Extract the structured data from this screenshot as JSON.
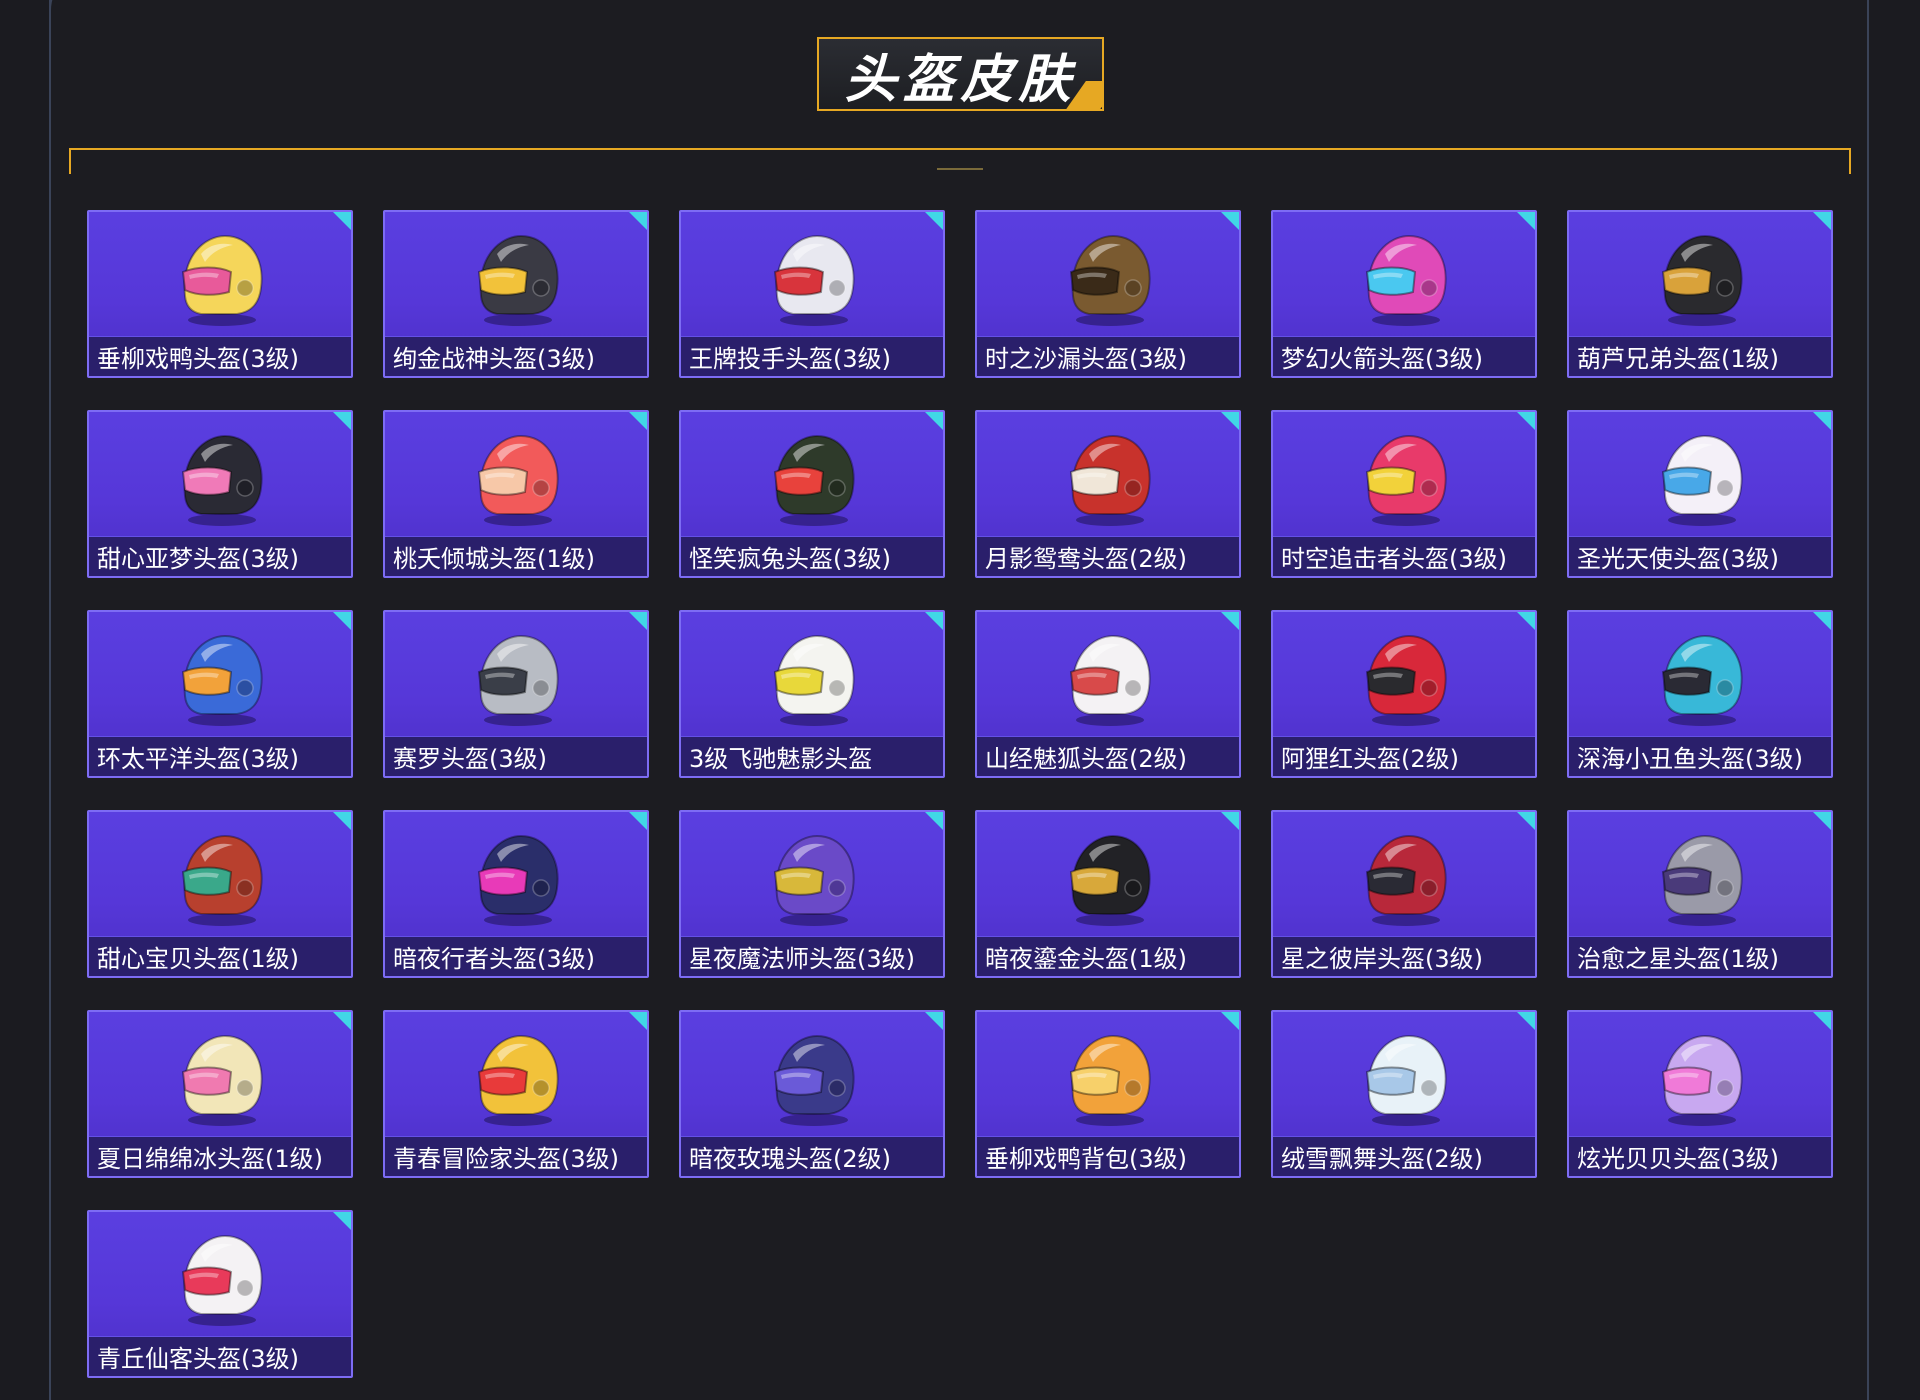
{
  "page": {
    "title": "头盔皮肤"
  },
  "colors": {
    "accent": "#e6a823",
    "card_bg": "#5a3fe0",
    "card_corner": "#41d7e6",
    "label_bg": "#2a1f6b"
  },
  "items": [
    {
      "label": "垂柳戏鸭头盔(3级)",
      "shell": "#f5d65a",
      "visor": "#e85a9a",
      "icon": "duck-helmet-icon"
    },
    {
      "label": "绚金战神头盔(3级)",
      "shell": "#3a3a44",
      "visor": "#f2c23a",
      "icon": "golden-warrior-helmet-icon"
    },
    {
      "label": "王牌投手头盔(3级)",
      "shell": "#e8e8f0",
      "visor": "#d8343c",
      "icon": "football-helmet-icon"
    },
    {
      "label": "时之沙漏头盔(3级)",
      "shell": "#7a5a30",
      "visor": "#3a2a18",
      "icon": "hourglass-helmet-icon"
    },
    {
      "label": "梦幻火箭头盔(3级)",
      "shell": "#e04ab8",
      "visor": "#4ac8f0",
      "icon": "rocket-helmet-icon"
    },
    {
      "label": "葫芦兄弟头盔(1级)",
      "shell": "#2a2a2e",
      "visor": "#d9a23a",
      "icon": "gourd-helmet-icon"
    },
    {
      "label": "甜心亚梦头盔(3级)",
      "shell": "#2a2a34",
      "visor": "#f07ab8",
      "icon": "sweet-dream-helmet-icon"
    },
    {
      "label": "桃夭倾城头盔(1级)",
      "shell": "#f25a5a",
      "visor": "#f7c8a8",
      "icon": "peach-helmet-icon"
    },
    {
      "label": "怪笑疯兔头盔(3级)",
      "shell": "#2e3a2a",
      "visor": "#e8423c",
      "icon": "crazy-rabbit-helmet-icon"
    },
    {
      "label": "月影鸳鸯头盔(2级)",
      "shell": "#c8322c",
      "visor": "#f0e6d8",
      "icon": "mandarin-duck-helmet-icon"
    },
    {
      "label": "时空追击者头盔(3级)",
      "shell": "#e83a6a",
      "visor": "#f2d23a",
      "icon": "time-chaser-helmet-icon"
    },
    {
      "label": "圣光天使头盔(3级)",
      "shell": "#f4f0f8",
      "visor": "#48a8e8",
      "icon": "angel-helmet-icon"
    },
    {
      "label": "环太平洋头盔(3级)",
      "shell": "#3a6ad8",
      "visor": "#f2a23a",
      "icon": "pacific-rim-helmet-icon"
    },
    {
      "label": "赛罗头盔(3级)",
      "shell": "#b8bcc4",
      "visor": "#3a3e48",
      "icon": "knight-helmet-icon"
    },
    {
      "label": "3级飞驰魅影头盔",
      "shell": "#f4f4f0",
      "visor": "#e8d83a",
      "icon": "phantom-helmet-icon"
    },
    {
      "label": "山经魅狐头盔(2级)",
      "shell": "#f4f2f4",
      "visor": "#d84a4a",
      "icon": "fox-helmet-icon"
    },
    {
      "label": "阿狸红头盔(2级)",
      "shell": "#d8283a",
      "visor": "#2a2a2e",
      "icon": "red-fox-helmet-icon"
    },
    {
      "label": "深海小丑鱼头盔(3级)",
      "shell": "#38b8d8",
      "visor": "#2a2a34",
      "icon": "clownfish-helmet-icon"
    },
    {
      "label": "甜心宝贝头盔(1级)",
      "shell": "#b8402e",
      "visor": "#3aa88a",
      "icon": "sweetheart-helmet-icon"
    },
    {
      "label": "暗夜行者头盔(3级)",
      "shell": "#2a2e6a",
      "visor": "#e83ab8",
      "icon": "night-walker-helmet-icon"
    },
    {
      "label": "星夜魔法师头盔(3级)",
      "shell": "#6a4ac8",
      "visor": "#d8b83a",
      "icon": "wizard-helmet-icon"
    },
    {
      "label": "暗夜鎏金头盔(1级)",
      "shell": "#222226",
      "visor": "#d8a83a",
      "icon": "black-gold-helmet-icon"
    },
    {
      "label": "星之彼岸头盔(3级)",
      "shell": "#b8283a",
      "visor": "#2a2a34",
      "icon": "star-shore-helmet-icon"
    },
    {
      "label": "治愈之星头盔(1级)",
      "shell": "#9a9aa8",
      "visor": "#4a3a7a",
      "icon": "healing-star-helmet-icon"
    },
    {
      "label": "夏日绵绵冰头盔(1级)",
      "shell": "#f2e6b8",
      "visor": "#f07ab0",
      "icon": "shaved-ice-helmet-icon"
    },
    {
      "label": "青春冒险家头盔(3级)",
      "shell": "#f2c23a",
      "visor": "#e83a3a",
      "icon": "adventurer-helmet-icon"
    },
    {
      "label": "暗夜玫瑰头盔(2级)",
      "shell": "#3a3a8a",
      "visor": "#6a5ad8",
      "icon": "night-rose-helmet-icon"
    },
    {
      "label": "垂柳戏鸭背包(3级)",
      "shell": "#f2a23a",
      "visor": "#f7d06a",
      "icon": "duck-backpack-icon"
    },
    {
      "label": "绒雪飘舞头盔(2级)",
      "shell": "#e8f2f8",
      "visor": "#a8c8e8",
      "icon": "snow-helmet-icon"
    },
    {
      "label": "炫光贝贝头盔(3级)",
      "shell": "#c8a8f0",
      "visor": "#f07ad8",
      "icon": "dazzle-bear-helmet-icon"
    },
    {
      "label": "青丘仙客头盔(3级)",
      "shell": "#f4f2f4",
      "visor": "#e83a5a",
      "icon": "fairy-fox-helmet-icon"
    }
  ]
}
